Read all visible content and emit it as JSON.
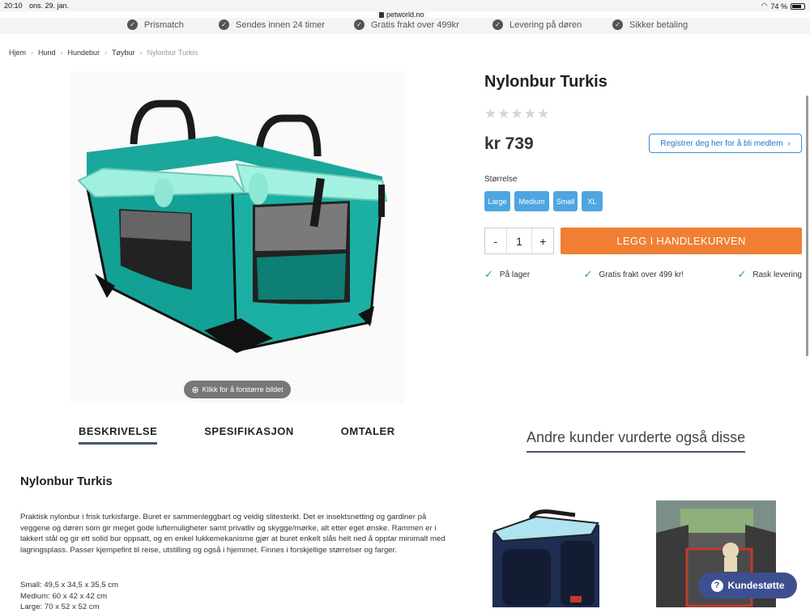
{
  "status_bar": {
    "time": "20:10",
    "date": "ons. 29. jan.",
    "battery": "74 %",
    "url": "petworld.no"
  },
  "usp": [
    "Prismatch",
    "Sendes innen 24 timer",
    "Gratis frakt over 499kr",
    "Levering på døren",
    "Sikker betaling"
  ],
  "breadcrumb": [
    "Hjem",
    "Hund",
    "Hundebur",
    "Tøybur",
    "Nylonbur Turkis"
  ],
  "product": {
    "title": "Nylonbur Turkis",
    "rating_stars": 0,
    "rating_max": 5,
    "price": "kr 739",
    "member_button": "Registrer deg her for å bli medlem",
    "size_label": "Størrelse",
    "sizes": [
      "Large",
      "Medium",
      "Small",
      "XL"
    ],
    "qty_minus": "-",
    "qty_value": "1",
    "qty_plus": "+",
    "cart_button": "LEGG I HANDLEKURVEN",
    "perks": [
      "På lager",
      "Gratis frakt over 499 kr!",
      "Rask levering"
    ],
    "zoom_hint": "Klikk for å forstørre bildet"
  },
  "tabs": [
    "BESKRIVELSE",
    "SPESIFIKASJON",
    "OMTALER"
  ],
  "others_title": "Andre kunder vurderte også disse",
  "description": {
    "title": "Nylonbur Turkis",
    "text": "Praktisk nylonbur i frisk turkisfarge. Buret er sammenleggbart og veldig slitesterkt. Det er insektsnetting og gardiner på veggene og døren som gir meget gode luftemuligheter samt privatliv og skygge/mørke, alt etter eget ønske. Rammen er i lakkert stål og gir ett solid bur oppsatt, og en enkel lukkemekanisme gjør at buret enkelt slås helt ned å opptar minimalt med lagringsplass. Passer kjempefint til reise, utstilling og også i hjemmet. Finnes i forskjellige størrelser og farger.",
    "specs": [
      "Small: 49,5 x 34,5 x 35,5 cm",
      "Medium: 60 x 42 x 42 cm",
      "Large: 70 x 52 x 52 cm"
    ]
  },
  "support_button": "Kundestøtte",
  "colors": {
    "accent_blue": "#4fa5df",
    "cart_orange": "#f07f33",
    "teal": "#20b2a6",
    "support_navy": "#3e4f91"
  }
}
